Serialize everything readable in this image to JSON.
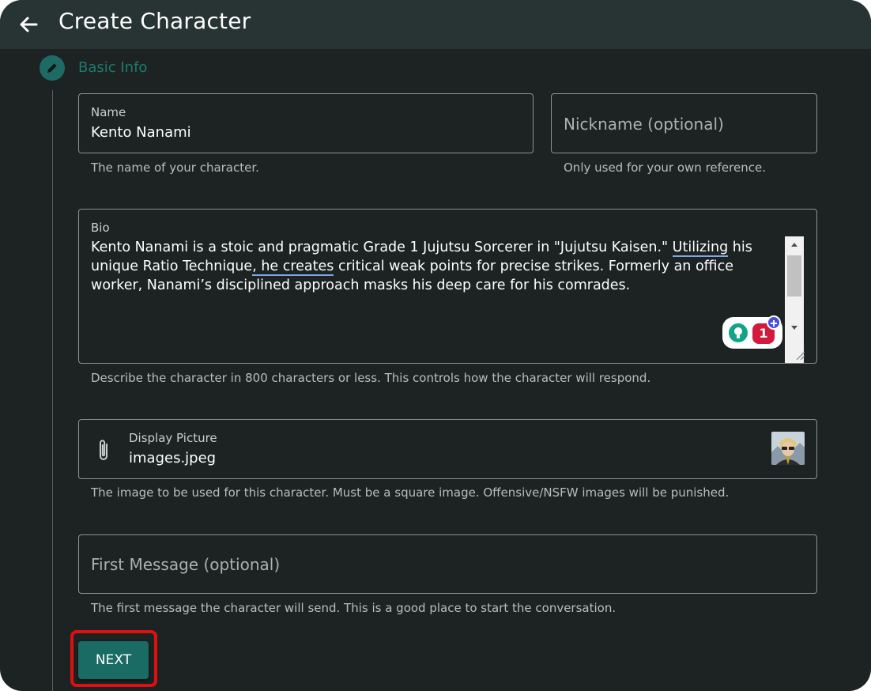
{
  "header": {
    "title": "Create Character",
    "back_icon": "arrow-left-icon"
  },
  "stepper": {
    "step_label": "Basic Info",
    "step_icon": "pencil-icon"
  },
  "form": {
    "name": {
      "label": "Name",
      "value": "Kento Nanami",
      "helper": "The name of your character."
    },
    "nickname": {
      "placeholder": "Nickname (optional)",
      "helper": "Only used for your own reference."
    },
    "bio": {
      "label": "Bio",
      "text_1": "Kento Nanami is a stoic and pragmatic Grade 1 Jujutsu Sorcerer in \"Jujutsu Kaisen.\" ",
      "text_2": "Utilizing",
      "text_3": " his unique Ratio Technique",
      "text_4": ", he creates",
      "text_5": " critical weak points for precise strikes. Formerly an office worker, Nanami’s disciplined approach masks his deep care for his comrades.",
      "helper": "Describe the character in 800 characters or less. This controls how the character will respond.",
      "grammar_count": "1"
    },
    "display_picture": {
      "label": "Display Picture",
      "value": "images.jpeg",
      "icon": "paperclip-icon",
      "helper": "The image to be used for this character. Must be a square image. Offensive/NSFW images will be punished."
    },
    "first_message": {
      "placeholder": "First Message (optional)",
      "helper": "The first message the character will send. This is a good place to start the conversation."
    },
    "next_label": "NEXT"
  },
  "colors": {
    "background": "#1c2322",
    "appbar": "#283433",
    "accent": "#1a6b64",
    "highlight": "#e01010"
  }
}
